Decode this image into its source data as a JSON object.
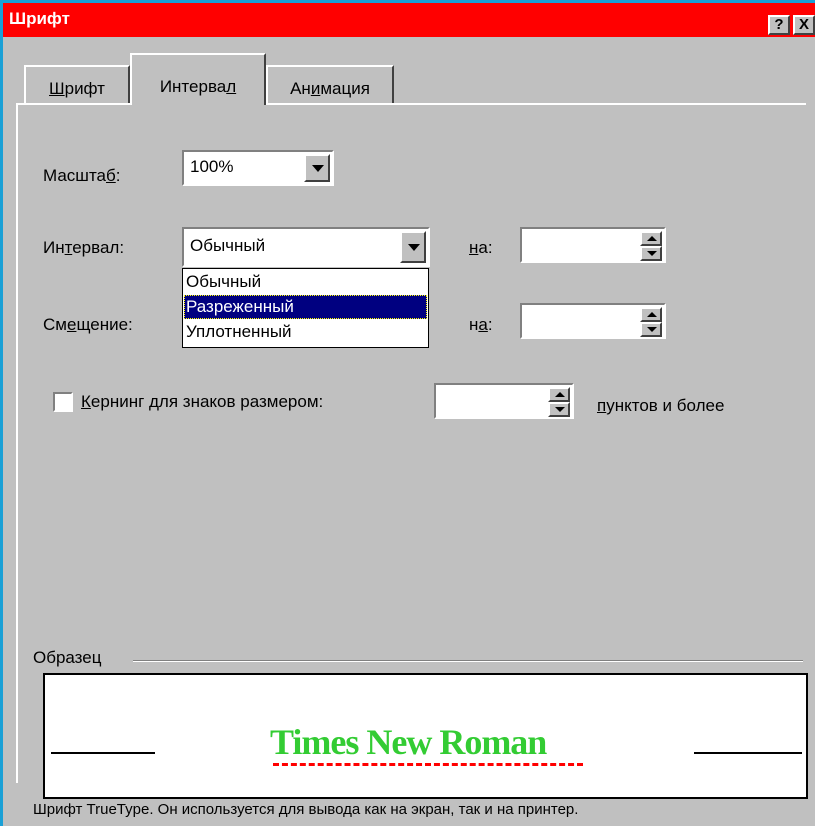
{
  "window": {
    "title": "Шрифт",
    "help_label": "?",
    "close_label": "X",
    "title_bar_color": "#ff0000"
  },
  "tabs": [
    {
      "label": "Шрифт",
      "active": false
    },
    {
      "label": "Интервал",
      "active": true
    },
    {
      "label": "Анимация",
      "active": false
    }
  ],
  "scale": {
    "label": "Масштаб:",
    "value": "100%"
  },
  "spacing": {
    "label": "Интервал:",
    "value": "Обычный",
    "by_label": "на:",
    "by_value": "",
    "options": [
      "Обычный",
      "Разреженный",
      "Уплотненный"
    ],
    "highlighted": "Разреженный"
  },
  "position": {
    "label": "Смещение:",
    "by_label": "на:",
    "by_value": ""
  },
  "kerning": {
    "label": "Кернинг для знаков размером:",
    "checked": false,
    "value": "",
    "suffix": "пунктов и более"
  },
  "preview": {
    "group_label": "Образец",
    "sample_text": "Times New Roman",
    "sample_color": "#33cc33",
    "underline_color": "#ff0000"
  },
  "footer": {
    "note": "Шрифт TrueType. Он используется для вывода как на экран, так и на принтер."
  }
}
